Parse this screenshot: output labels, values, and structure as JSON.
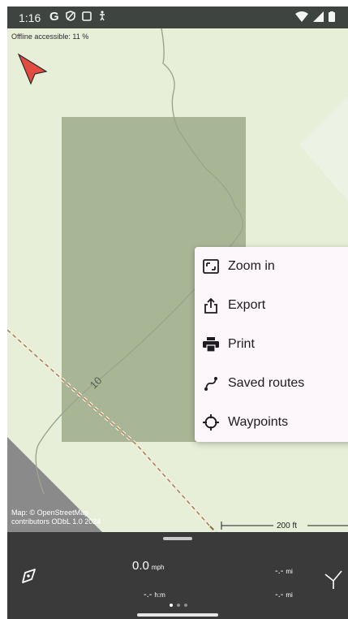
{
  "status_bar": {
    "time": "1:16",
    "left_icons": [
      "google-icon",
      "shield-icon",
      "screen-icon",
      "accessibility-icon"
    ],
    "right_icons": [
      "wifi-icon",
      "signal-icon",
      "battery-icon"
    ]
  },
  "map": {
    "offline_text": "Offline accessible: 11 %",
    "route_label": "10",
    "attribution_line1": "Map: © OpenStreetMap",
    "attribution_line2": "contributors ODbL 1.0 2024",
    "scale_label": "200 ft"
  },
  "menu": {
    "items": [
      {
        "label": "Zoom in",
        "icon": "zoom-in-icon"
      },
      {
        "label": "Export",
        "icon": "export-icon"
      },
      {
        "label": "Print",
        "icon": "print-icon"
      },
      {
        "label": "Saved routes",
        "icon": "route-icon"
      },
      {
        "label": "Waypoints",
        "icon": "waypoint-icon"
      }
    ]
  },
  "bottom_panel": {
    "speed_value": "0.0",
    "speed_unit": "mph",
    "distance_value": "-.-",
    "distance_unit": "mi",
    "time_value": "-.-",
    "time_unit": "h:m",
    "distance2_value": "-.-",
    "distance2_unit": "mi",
    "page_count": 3,
    "active_page": 1
  },
  "colors": {
    "map_background": "#e7efd9",
    "overlay_rect": "#a9b696",
    "route_dash": "#b98d5b",
    "menu_background": "#fdf7fb",
    "panel_background": "#3a3a3a"
  }
}
